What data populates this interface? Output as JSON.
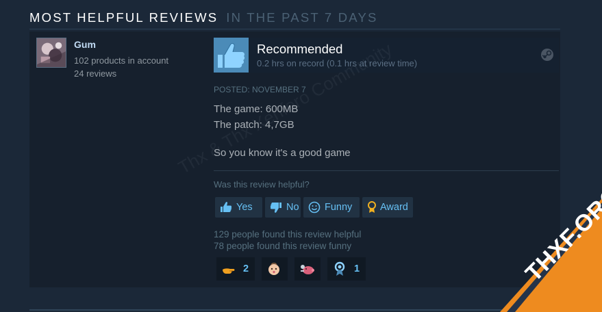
{
  "section": {
    "title": "MOST HELPFUL REVIEWS",
    "subtitle": "IN THE PAST 7 DAYS"
  },
  "user": {
    "name": "Gum",
    "products": "102 products in account",
    "reviews": "24 reviews"
  },
  "review": {
    "verdict": "Recommended",
    "hours": "0.2 hrs on record (0.1 hrs at review time)",
    "posted": "POSTED: NOVEMBER 7",
    "lines": [
      "The game: 600MB",
      "The patch: 4,7GB",
      "So you know it's a good game"
    ],
    "helpful_question": "Was this review helpful?",
    "buttons": {
      "yes": "Yes",
      "no": "No",
      "funny": "Funny",
      "award": "Award"
    },
    "helpful_count": "129 people found this review helpful",
    "funny_count": "78 people found this review funny",
    "awards": [
      {
        "icon": "hand-icon",
        "count": "2"
      },
      {
        "icon": "baby-face-icon",
        "count": ""
      },
      {
        "icon": "pig-icon",
        "count": ""
      },
      {
        "icon": "ribbon-icon",
        "count": "1"
      }
    ]
  },
  "watermark": {
    "text": "Thx & Thx Xenforo Community",
    "badge": "THXF.ORG"
  },
  "colors": {
    "background": "#1b2838",
    "panel": "#16202d",
    "accent": "#66c0f4",
    "thumb": "#4b8bb8",
    "badge_orange": "#ee8b1f"
  }
}
